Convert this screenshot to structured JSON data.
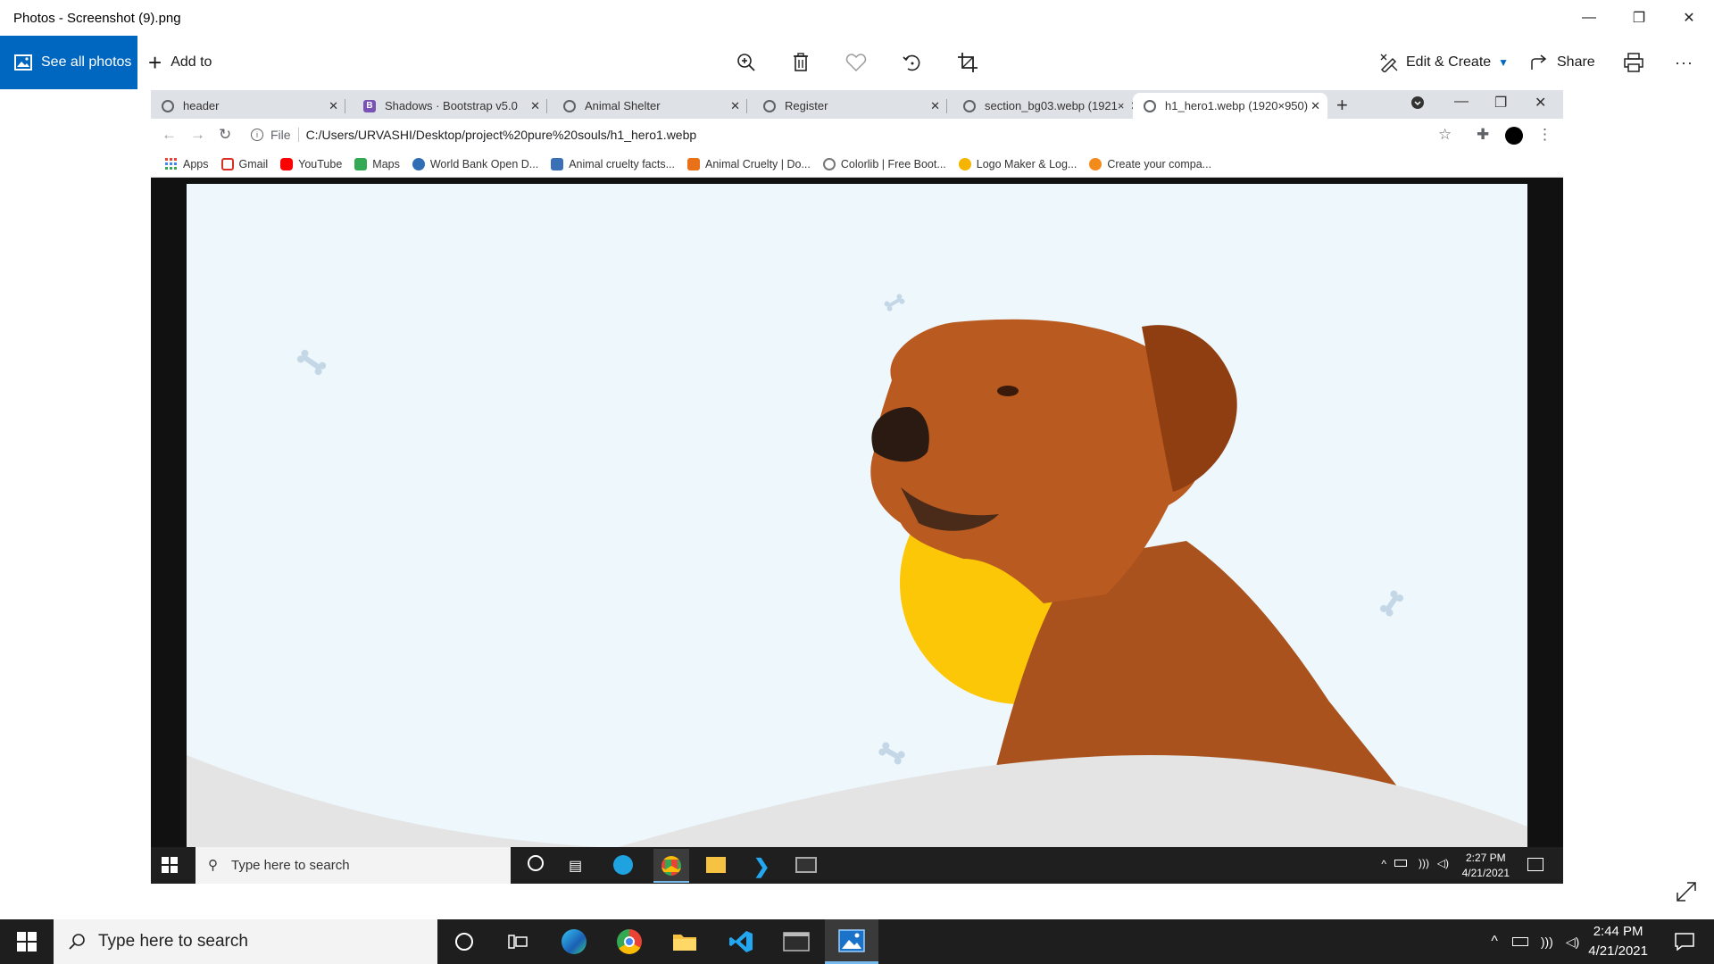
{
  "window": {
    "title": "Photos - Screenshot (9).png",
    "controls": [
      "—",
      "❐",
      "✕"
    ]
  },
  "toolbar": {
    "see_all_label": "See all photos",
    "add_to_label": "Add to",
    "edit_create_label": "Edit & Create",
    "share_label": "Share",
    "more_label": "···"
  },
  "chrome": {
    "tabs": [
      {
        "label": "header",
        "icon": "globe-icon"
      },
      {
        "label": "Shadows · Bootstrap v5.0",
        "icon": "bootstrap-icon",
        "favicon_text": "B"
      },
      {
        "label": "Animal Shelter",
        "icon": "globe-icon"
      },
      {
        "label": "Register",
        "icon": "globe-icon"
      },
      {
        "label": "section_bg03.webp (1921×",
        "icon": "globe-icon"
      },
      {
        "label": "h1_hero1.webp (1920×950)",
        "icon": "globe-icon",
        "active": true
      }
    ],
    "new_tab": "+",
    "address": {
      "scheme_label": "File",
      "url": "C:/Users/URVASHI/Desktop/project%20pure%20souls/h1_hero1.webp"
    },
    "bookmarks": [
      {
        "label": "Apps",
        "color": "#ea4335"
      },
      {
        "label": "Gmail",
        "color": "#d93025"
      },
      {
        "label": "YouTube",
        "color": "#ff0000"
      },
      {
        "label": "Maps",
        "color": "#34a853"
      },
      {
        "label": "World Bank Open D...",
        "color": "#2f6db5"
      },
      {
        "label": "Animal cruelty facts...",
        "color": "#3b6fb6"
      },
      {
        "label": "Animal Cruelty | Do...",
        "color": "#e8711a"
      },
      {
        "label": "Colorlib | Free Boot...",
        "color": "#777777"
      },
      {
        "label": "Logo Maker & Log...",
        "color": "#f4b400"
      },
      {
        "label": "Create your compa...",
        "color": "#f28b1b"
      }
    ]
  },
  "inner_taskbar": {
    "search_placeholder": "Type here to search",
    "time": "2:27 PM",
    "date": "4/21/2021"
  },
  "taskbar": {
    "search_placeholder": "Type here to search",
    "time": "2:44 PM",
    "date": "4/21/2021"
  },
  "colors": {
    "accent": "#0067c0",
    "hero_bg": "#eef7fc",
    "sun": "#fcc707",
    "dog": "#b5581f"
  }
}
